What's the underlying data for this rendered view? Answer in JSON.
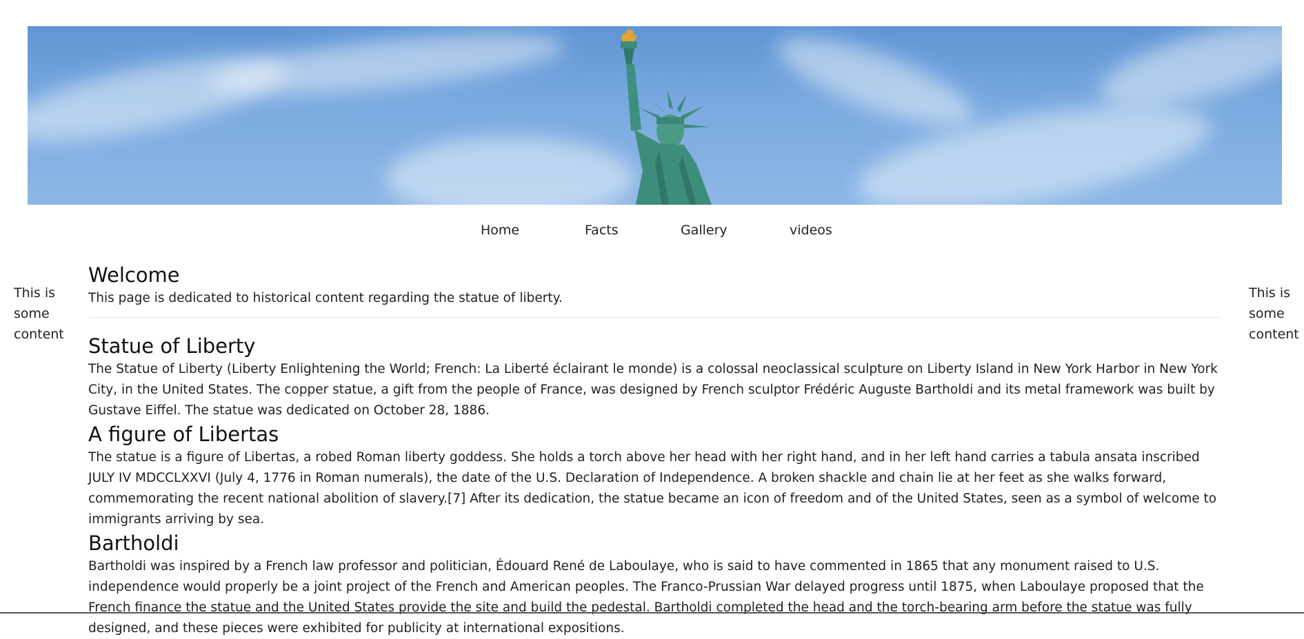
{
  "banner": {
    "image_alt": "Statue of Liberty against blue sky",
    "sky_color": "#6fa2dc"
  },
  "nav": {
    "items": [
      "Home",
      "Facts",
      "Gallery",
      "videos"
    ]
  },
  "sidebar_left": {
    "lines": [
      "This is",
      "some",
      "content"
    ]
  },
  "sidebar_right": {
    "lines": [
      "This is",
      "some",
      "content"
    ]
  },
  "main": {
    "welcome_title": "Welcome",
    "welcome_text": "This page is dedicated to historical content regarding the statue of liberty.",
    "sections": [
      {
        "title": "Statue of Liberty",
        "text": "The Statue of Liberty (Liberty Enlightening the World; French: La Liberté éclairant le monde) is a colossal neoclassical sculpture on Liberty Island in New York Harbor in New York City, in the United States. The copper statue, a gift from the people of France, was designed by French sculptor Frédéric Auguste Bartholdi and its metal framework was built by Gustave Eiffel. The statue was dedicated on October 28, 1886."
      },
      {
        "title": "A figure of Libertas",
        "text": "The statue is a figure of Libertas, a robed Roman liberty goddess. She holds a torch above her head with her right hand, and in her left hand carries a tabula ansata inscribed JULY IV MDCCLXXVI (July 4, 1776 in Roman numerals), the date of the U.S. Declaration of Independence. A broken shackle and chain lie at her feet as she walks forward, commemorating the recent national abolition of slavery.[7] After its dedication, the statue became an icon of freedom and of the United States, seen as a symbol of welcome to immigrants arriving by sea."
      },
      {
        "title": "Bartholdi",
        "text": "Bartholdi was inspired by a French law professor and politician, Édouard René de Laboulaye, who is said to have commented in 1865 that any monument raised to U.S. independence would properly be a joint project of the French and American peoples. The Franco-Prussian War delayed progress until 1875, when Laboulaye proposed that the French finance the statue and the United States provide the site and build the pedestal. Bartholdi completed the head and the torch-bearing arm before the statue was fully designed, and these pieces were exhibited for publicity at international expositions."
      }
    ]
  }
}
